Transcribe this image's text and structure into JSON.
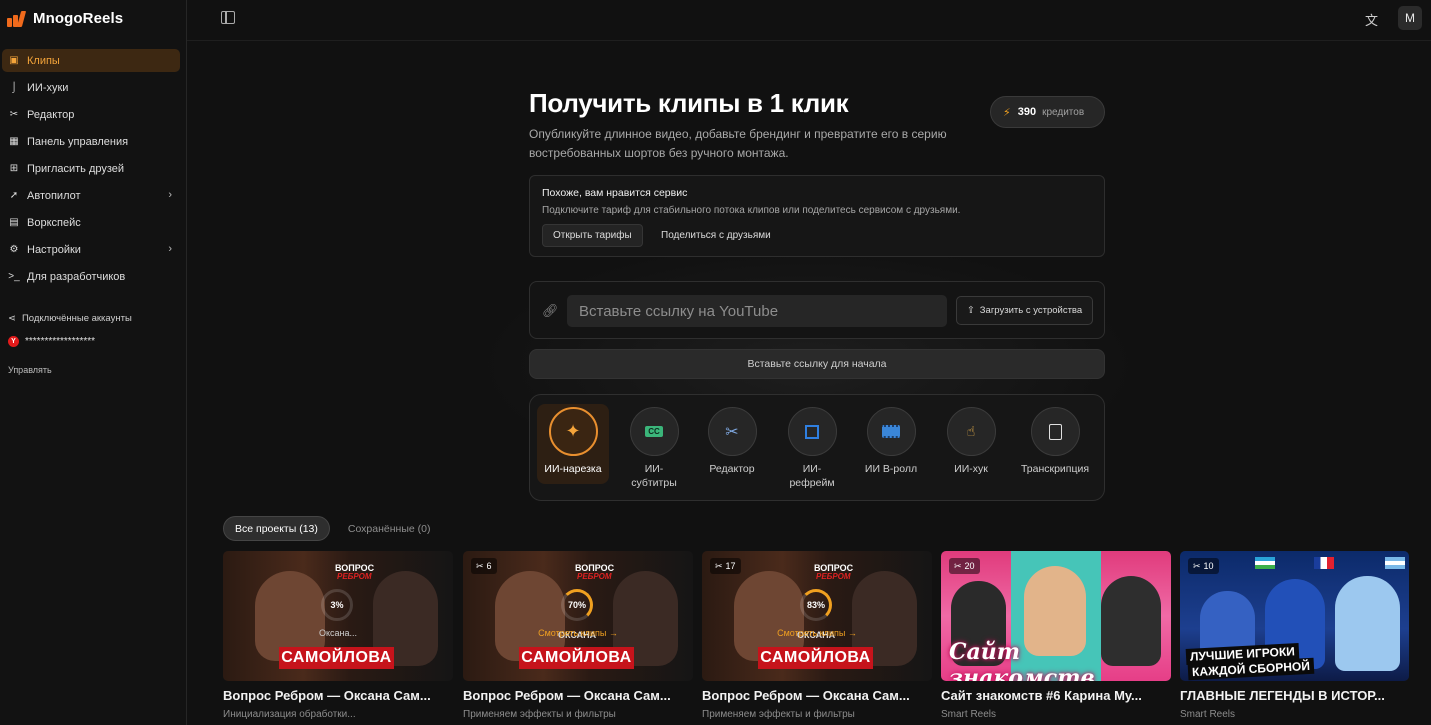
{
  "app": {
    "name": "MnogoReels"
  },
  "sidebar": {
    "items": [
      {
        "label": "Клипы",
        "icon": "clips-icon",
        "active": true
      },
      {
        "label": "ИИ-хуки",
        "icon": "hook-icon"
      },
      {
        "label": "Редактор",
        "icon": "scissors-icon"
      },
      {
        "label": "Панель управления",
        "icon": "dashboard-icon"
      },
      {
        "label": "Пригласить друзей",
        "icon": "gift-icon"
      },
      {
        "label": "Автопилот",
        "icon": "rocket-icon",
        "chevron": true
      },
      {
        "label": "Воркспейс",
        "icon": "building-icon"
      },
      {
        "label": "Настройки",
        "icon": "gear-icon",
        "chevron": true
      },
      {
        "label": "Для разработчиков",
        "icon": "terminal-icon"
      }
    ],
    "accounts_heading": "Подключённые аккаунты",
    "account_name": "******************",
    "account_badge": "Y",
    "manage_label": "Управлять"
  },
  "topbar": {
    "avatar_letter": "M",
    "translate_icon": "translate-icon"
  },
  "hero": {
    "title": "Получить клипы в 1 клик",
    "subtitle": "Опубликуйте длинное видео, добавьте брендинг и превратите его в серию востребованных шортов без ручного монтажа.",
    "credits_value": "390",
    "credits_unit": "кредитов"
  },
  "notice": {
    "title": "Похоже, вам нравится сервис",
    "text": "Подключите тариф для стабильного потока клипов или поделитесь сервисом с друзьями.",
    "tariffs_button": "Открыть тарифы",
    "share_button": "Поделиться с друзьями"
  },
  "url_form": {
    "placeholder": "Вставьте ссылку на YouTube",
    "upload_button": "Загрузить с устройства",
    "start_button": "Вставьте ссылку для начала"
  },
  "tools": [
    {
      "label": "ИИ-нарезка",
      "icon": "sparkle-icon",
      "active": true
    },
    {
      "label": "ИИ-субтитры",
      "icon": "captions-icon"
    },
    {
      "label": "Редактор",
      "icon": "scissors-icon"
    },
    {
      "label": "ИИ-рефрейм",
      "icon": "crop-icon"
    },
    {
      "label": "ИИ B-ролл",
      "icon": "film-icon"
    },
    {
      "label": "ИИ-хук",
      "icon": "hook-hand-icon"
    },
    {
      "label": "Транскрипция",
      "icon": "document-icon"
    }
  ],
  "tabs": [
    {
      "label": "Все проекты (13)",
      "active": true
    },
    {
      "label": "Сохранённые (0)"
    }
  ],
  "thumb_text": {
    "vopros": "ВОПРОС",
    "rebrom": "РЕБРОМ",
    "oksana": "ОКСАНА",
    "samoylova": "САМОЙЛОВА",
    "sayt": "Сайт знакомств",
    "best1": "ЛУЧШИЕ ИГРОКИ",
    "best2": "КАЖДОЙ СБОРНОЙ"
  },
  "projects": [
    {
      "title": "Вопрос Ребром — Оксана Сам...",
      "subtitle": "Инициализация обработки...",
      "progress": "3%",
      "status": "Оксана...",
      "count": ""
    },
    {
      "title": "Вопрос Ребром — Оксана Сам...",
      "subtitle": "Применяем эффекты и фильтры",
      "progress": "70%",
      "status": "Смотреть клипы →",
      "count": "6"
    },
    {
      "title": "Вопрос Ребром — Оксана Сам...",
      "subtitle": "Применяем эффекты и фильтры",
      "progress": "83%",
      "status": "Смотреть клипы →",
      "count": "17"
    },
    {
      "title": "Сайт знакомств #6 Карина Му...",
      "subtitle": "Smart Reels",
      "count": "20"
    },
    {
      "title": "ГЛАВНЫЕ ЛЕГЕНДЫ В ИСТОР...",
      "subtitle": "Smart Reels",
      "count": "10"
    }
  ]
}
